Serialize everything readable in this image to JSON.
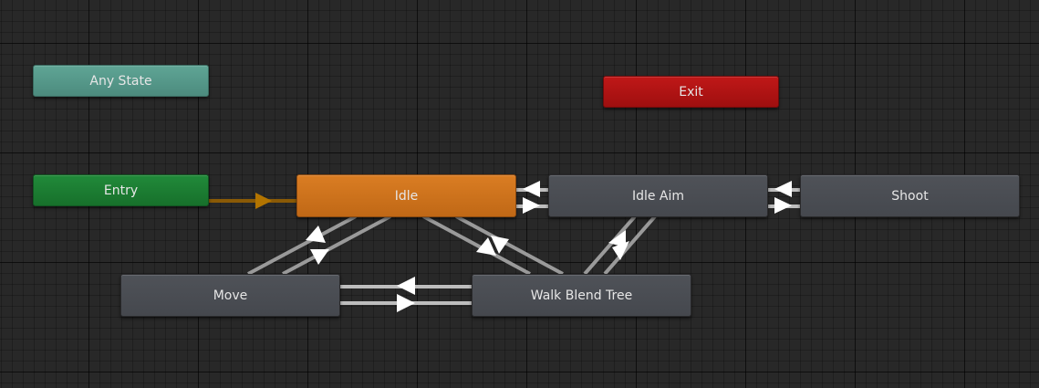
{
  "nodes": {
    "any_state": "Any State",
    "entry": "Entry",
    "exit": "Exit",
    "idle": "Idle",
    "idle_aim": "Idle Aim",
    "shoot": "Shoot",
    "move": "Move",
    "walk_blend_tree": "Walk Blend Tree"
  },
  "colors": {
    "any_state": "#56998a",
    "entry": "#1c7d33",
    "exit": "#b01414",
    "default_state": "#cd721c",
    "state": "#4a4d53",
    "transition": "#c8c8c8",
    "entry_transition": "#8a5a06"
  }
}
